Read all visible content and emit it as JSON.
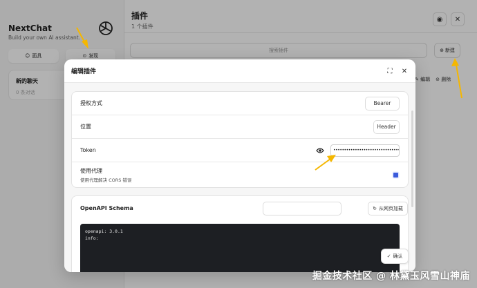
{
  "sidebar": {
    "brand_title": "NextChat",
    "brand_subtitle": "Build your own AI assistant.",
    "mask_button": "面具",
    "discover_button": "发现",
    "chat_item_title": "新的聊天",
    "chat_item_count": "0 条对话"
  },
  "main": {
    "title": "插件",
    "subtitle": "1 个插件",
    "search_placeholder": "搜索插件",
    "new_button": "新建",
    "edit_action": "编辑",
    "delete_action": "删除"
  },
  "modal": {
    "title": "编辑插件",
    "auth_label": "授权方式",
    "auth_value": "Bearer",
    "location_label": "位置",
    "location_value": "Header",
    "token_label": "Token",
    "token_value": "••••••••••••••••••••••••••••••••",
    "proxy_label": "使用代理",
    "proxy_desc": "使用代理解决 CORS 错误",
    "schema_label": "OpenAPI Schema",
    "load_button": "从网页加载",
    "code": "openapi: 3.0.1\ninfo:",
    "confirm_button": "确认"
  },
  "watermark": "掘金技术社区 @ 林黛玉风雪山神庙",
  "colors": {
    "accent": "#3b5bdb",
    "arrow": "#f5b700"
  },
  "icons": [
    "openai-logo-icon",
    "mask-icon",
    "compass-icon",
    "github-icon",
    "close-icon",
    "plus-circle-icon",
    "edit-icon",
    "delete-icon",
    "maximize-icon",
    "eye-icon",
    "reload-icon",
    "check-icon"
  ]
}
